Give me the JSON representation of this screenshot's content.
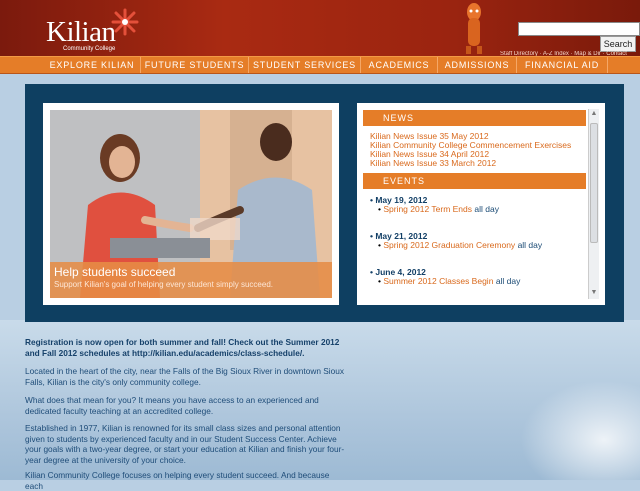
{
  "header": {
    "logo_name": "Kilian",
    "logo_sub": "Community College",
    "search_button": "Search",
    "search_value": "",
    "utility_links": "Staff Directory · A-Z Index · Map & Dir · Contact"
  },
  "nav": {
    "items": [
      "EXPLORE KILIAN",
      "FUTURE STUDENTS",
      "STUDENT SERVICES",
      "ACADEMICS",
      "ADMISSIONS",
      "FINANCIAL AID"
    ]
  },
  "feature": {
    "title": "Help students succeed",
    "text": "Support Kilian's goal of helping every student simply succeed."
  },
  "news": {
    "heading": "NEWS",
    "items": [
      "Kilian News Issue 35 May 2012",
      "Kilian Community College Commencement Exercises",
      "Kilian News Issue 34 April 2012",
      "Kilian News Issue 33 March 2012"
    ]
  },
  "events": {
    "heading": "EVENTS",
    "items": [
      {
        "date": "May 19, 2012",
        "title": "Spring 2012 Term Ends",
        "when": "all day"
      },
      {
        "date": "May 21, 2012",
        "title": "Spring 2012 Graduation Ceremony",
        "when": "all day"
      },
      {
        "date": "June 4, 2012",
        "title": "Summer 2012 Classes Begin",
        "when": "all day"
      }
    ]
  },
  "body": {
    "announcement": "Registration is now open for both summer and fall!  Check out the Summer 2012 and Fall 2012 schedules at http://kilian.edu/academics/class-schedule/.",
    "p1": "Located in the heart of the city, near the Falls of the Big Sioux River in downtown Sioux Falls, Kilian is the city's only community college.",
    "p2": "What does that mean for you? It means you have access to an experienced and dedicated faculty teaching at an accredited college.",
    "p3": "Established in 1977, Kilian is renowned for its small class sizes and personal attention given to students by experienced faculty and in our Student Success Center. Achieve your goals with a two-year degree, or start your education at Kilian and finish your four-year degree at the university of your choice.",
    "p4": "Kilian Community College focuses on helping every student succeed. And because each"
  },
  "colors": {
    "header_red": "#9b2410",
    "nav_orange": "#e57d28",
    "stage_navy": "#0e3f61",
    "link_orange": "#d9691c",
    "text_blue": "#1e4c78"
  }
}
